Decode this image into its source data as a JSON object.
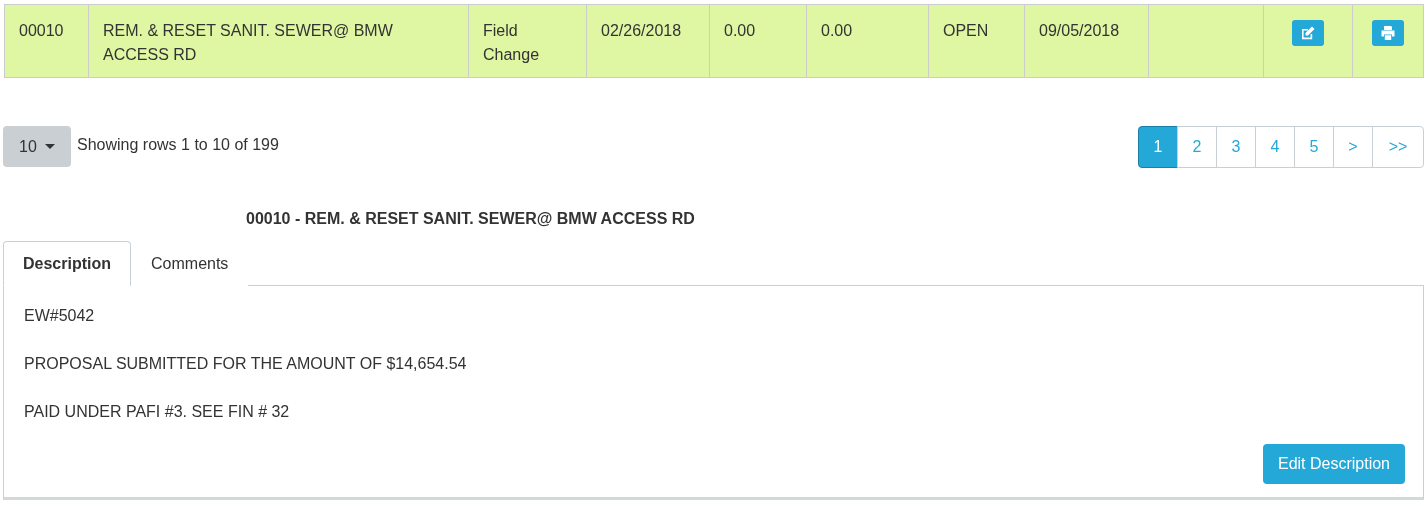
{
  "table": {
    "rows": [
      {
        "cells": [
          {
            "kind": "text",
            "text": "00010"
          },
          {
            "kind": "text",
            "text": "REM. & RESET SANIT. SEWER@ BMW ACCESS RD"
          },
          {
            "kind": "text",
            "text": "Field Change"
          },
          {
            "kind": "text",
            "text": "02/26/2018"
          },
          {
            "kind": "text",
            "text": "0.00"
          },
          {
            "kind": "text",
            "text": "0.00"
          },
          {
            "kind": "text",
            "text": "OPEN"
          },
          {
            "kind": "text",
            "text": "09/05/2018"
          },
          {
            "kind": "empty"
          },
          {
            "kind": "edit"
          },
          {
            "kind": "print"
          }
        ]
      }
    ]
  },
  "pager": {
    "page_size": "10",
    "summary": "Showing rows 1 to 10 of 199",
    "pages": [
      {
        "label": "1",
        "selected": true
      },
      {
        "label": "2",
        "selected": false
      },
      {
        "label": "3",
        "selected": false
      },
      {
        "label": "4",
        "selected": false
      },
      {
        "label": "5",
        "selected": false
      },
      {
        "label": ">",
        "selected": false
      },
      {
        "label": ">>",
        "selected": false
      }
    ]
  },
  "detail": {
    "title": "00010 - REM. & RESET SANIT. SEWER@ BMW ACCESS RD",
    "tabs": [
      {
        "label": "Description",
        "selected": true
      },
      {
        "label": "Comments",
        "selected": false
      }
    ],
    "paragraphs": [
      "EW#5042",
      "PROPOSAL SUBMITTED FOR THE AMOUNT OF $14,654.54",
      "PAID UNDER PAFI #3. SEE FIN # 32"
    ],
    "button": "Edit Description"
  }
}
